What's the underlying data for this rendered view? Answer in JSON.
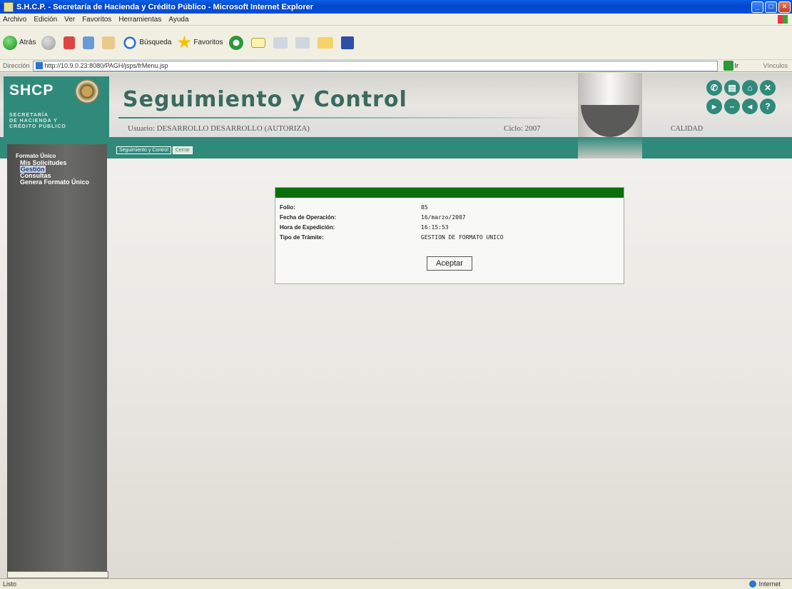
{
  "window": {
    "title": "S.H.C.P. - Secretaría de Hacienda y Crédito Público - Microsoft Internet Explorer",
    "buttons": {
      "minimize": "_",
      "maximize": "□",
      "close": "×"
    }
  },
  "menu": [
    "Archivo",
    "Edición",
    "Ver",
    "Favoritos",
    "Herramientas",
    "Ayuda"
  ],
  "toolbar": {
    "back": "Atrás",
    "search": "Búsqueda",
    "favorites": "Favoritos"
  },
  "address": {
    "label": "Dirección",
    "url": "http://10.9.0.23:8080/PAGH/jsps/frMenu.jsp",
    "go": "Ir",
    "links": "Vínculos"
  },
  "header": {
    "logo": "SHCP",
    "logo_sub": [
      "SECRETARÍA",
      "DE HACIENDA Y",
      "CRÉDITO PÚBLICO"
    ],
    "title": "Seguimiento y Control",
    "usuario": "Usuario: DESARROLLO DESARROLLO (AUTORIZA)",
    "ciclo": "Ciclo: 2007",
    "calidad": "CALIDAD"
  },
  "tabs": [
    "Seguimiento y Control",
    "Cerrar"
  ],
  "sidebar": {
    "title": "Formato Único",
    "items": [
      "Mis Solicitudes",
      "Gestión",
      "Consultas",
      "Genera Formato Único"
    ]
  },
  "panel": {
    "rows": [
      {
        "label": "Folio:",
        "value": "85"
      },
      {
        "label": "Fecha de Operación:",
        "value": "16/marzo/2007"
      },
      {
        "label": "Hora de Expedición:",
        "value": "16:15:53"
      },
      {
        "label": "Tipo de Trámite:",
        "value": "GESTION DE FORMATO UNICO"
      }
    ],
    "button": "Aceptar"
  },
  "status": {
    "left": "Listo",
    "zone": "Internet"
  }
}
